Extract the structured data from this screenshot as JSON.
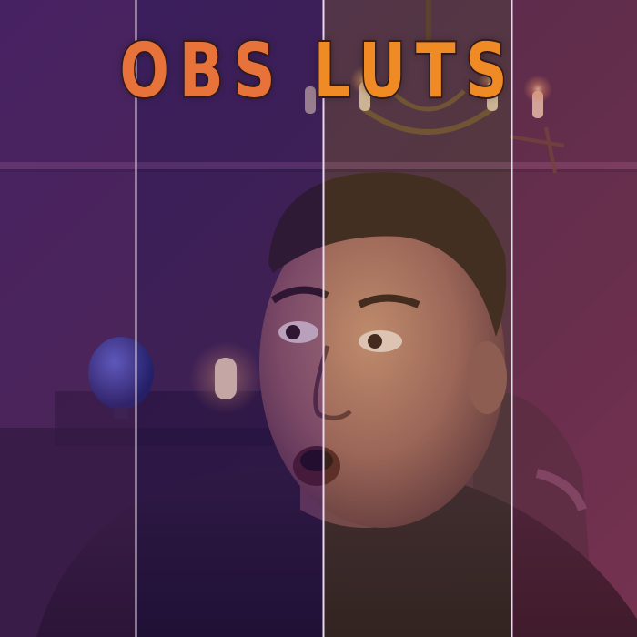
{
  "title": {
    "word1": "OBS",
    "word2": "LUTS"
  },
  "colors": {
    "word1": "#e8733a",
    "word2": "#f08a24",
    "outline": "#3a1f1f",
    "divider": "#e9d7ee"
  },
  "panels": [
    {
      "name": "lut-panel-1",
      "tint": "#6a2a8a"
    },
    {
      "name": "lut-panel-2",
      "tint": "#4a2a78"
    },
    {
      "name": "lut-panel-3",
      "tint": "#8a6a3a"
    },
    {
      "name": "lut-panel-4",
      "tint": "#a04a6a"
    }
  ]
}
